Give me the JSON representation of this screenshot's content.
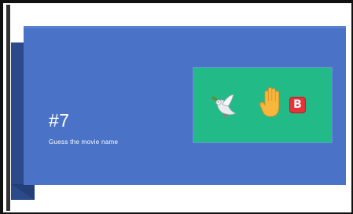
{
  "slide": {
    "title": "#7",
    "subtitle": "Guess the movie name"
  },
  "emojis": [
    {
      "icon": "dove-icon"
    },
    {
      "icon": "raised-hand-icon"
    },
    {
      "icon": "b-button-icon",
      "label": "B"
    }
  ],
  "colors": {
    "slide_background": "#4a72c7",
    "emoji_box": "#22bb88",
    "text": "#ffffff",
    "badge": "#e5333a"
  }
}
